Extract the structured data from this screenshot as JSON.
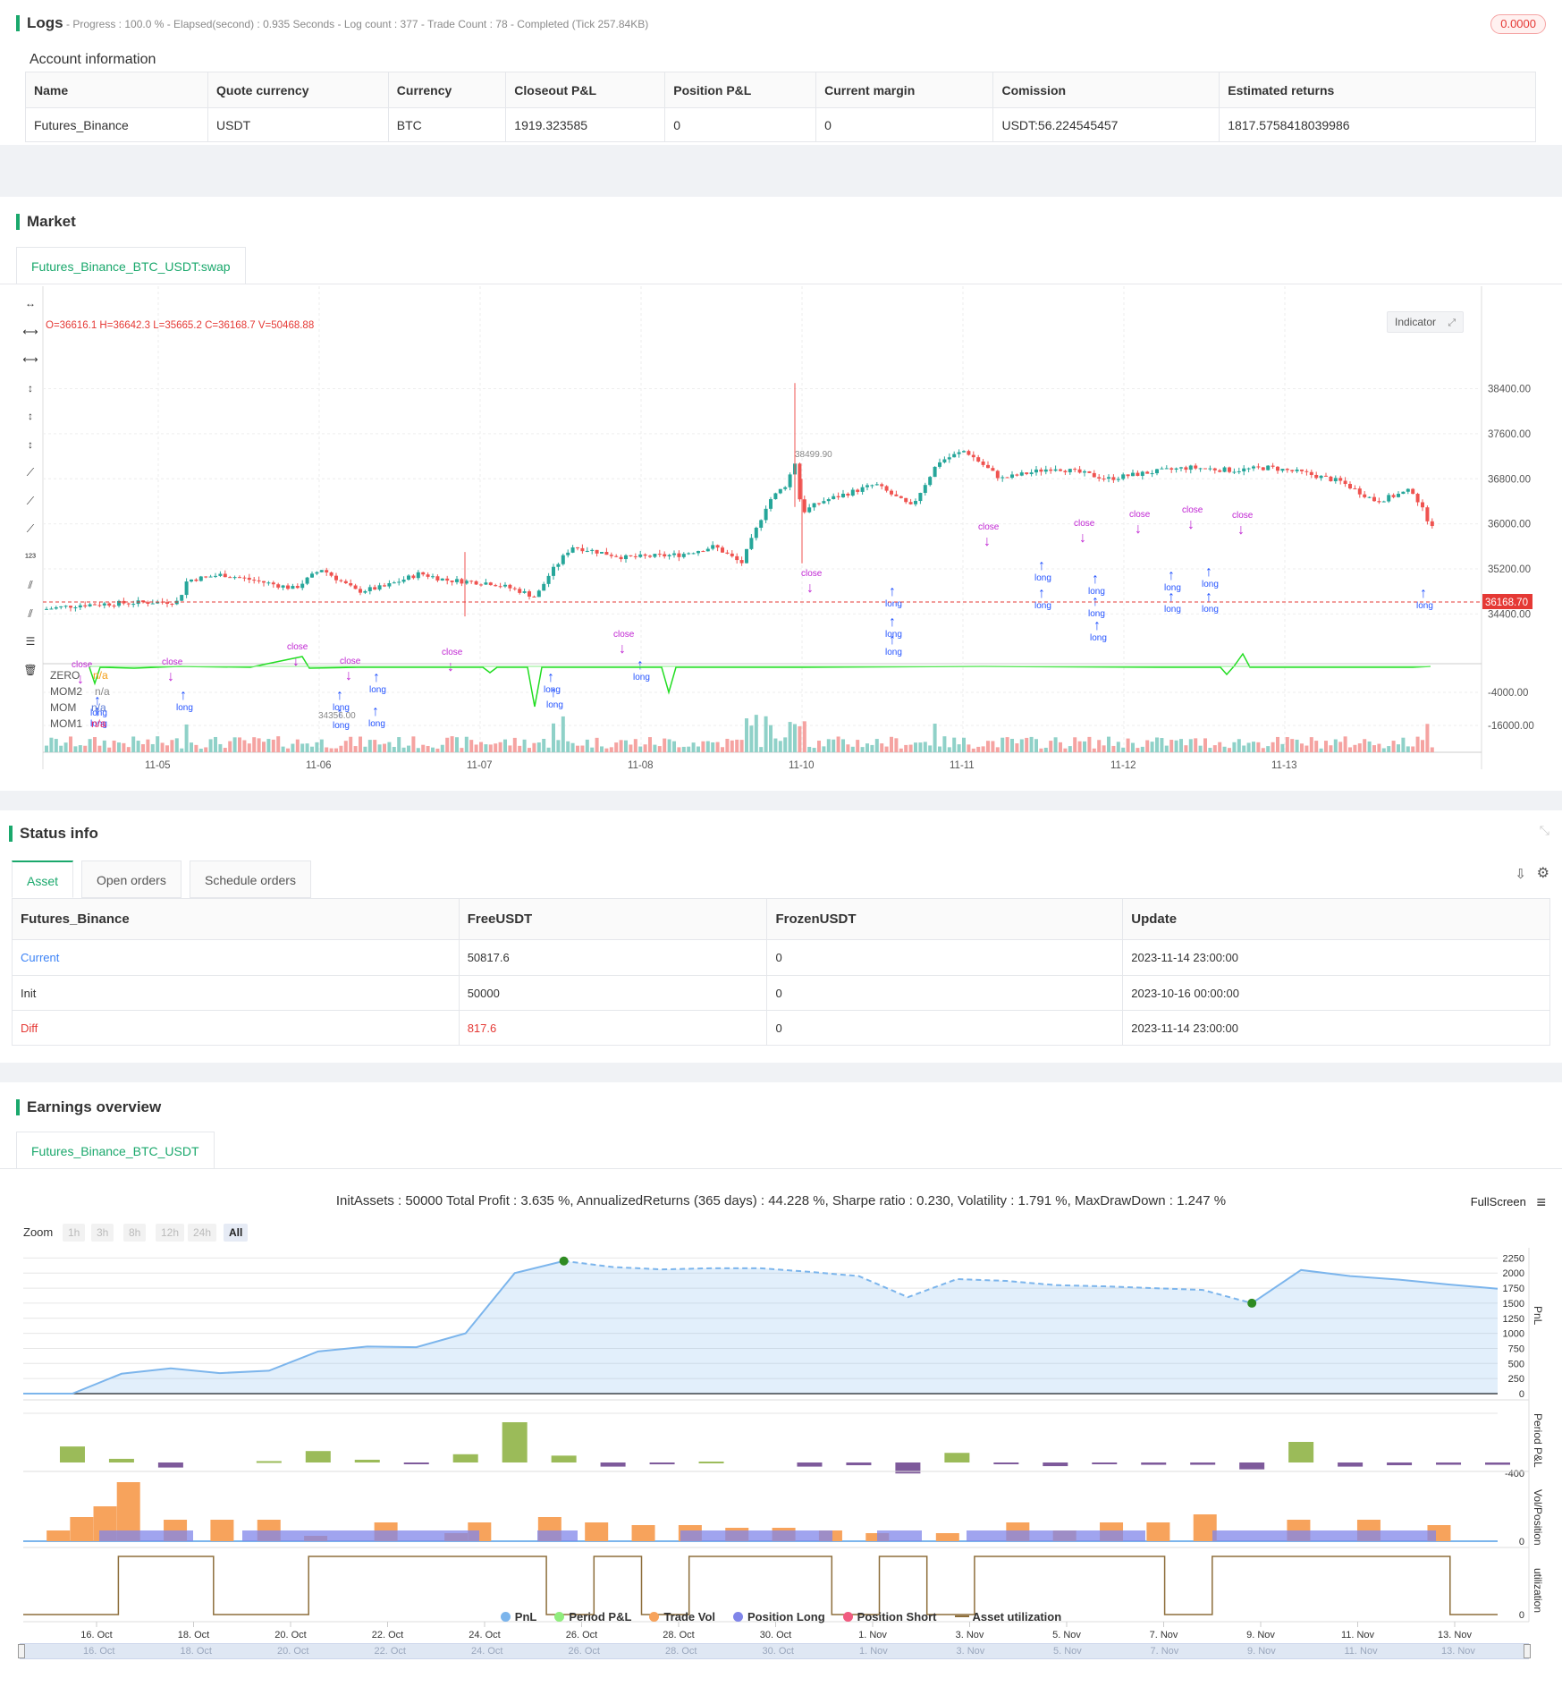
{
  "logs": {
    "title": "Logs",
    "progress_line": "- Progress : 100.0 % - Elapsed(second) : 0.935  Seconds - Log count : 377 - Trade Count : 78 - Completed (Tick 257.84KB)",
    "badge": "0.0000"
  },
  "account": {
    "heading": "Account information",
    "columns": [
      "Name",
      "Quote currency",
      "Currency",
      "Closeout P&L",
      "Position P&L",
      "Current margin",
      "Comission",
      "Estimated returns"
    ],
    "row": [
      "Futures_Binance",
      "USDT",
      "BTC",
      "1919.323585",
      "0",
      "0",
      "USDT:56.224545457",
      "1817.5758418039986"
    ]
  },
  "market": {
    "title": "Market",
    "tab": "Futures_Binance_BTC_USDT:swap",
    "ohlc": "O=36616.1 H=36642.3 L=35665.2 C=36168.7 V=50468.88",
    "indicator_btn": "Indicator",
    "price_axis": [
      "38400.00",
      "37600.00",
      "36800.00",
      "36000.00",
      "35200.00",
      "34400.00"
    ],
    "current_price": "36168.70",
    "high_label": "38499.90",
    "low_label": "34356.00",
    "mom_axis": [
      "-4000.00",
      "-16000.00"
    ],
    "date_axis": [
      "11-05",
      "11-06",
      "11-07",
      "11-08",
      "11-10",
      "11-11",
      "11-12",
      "11-13"
    ],
    "legend": [
      {
        "name": "ZERO",
        "value": "n/a",
        "color": "#f39c12"
      },
      {
        "name": "MOM2",
        "value": "n/a",
        "color": "#888888"
      },
      {
        "name": "MOM",
        "value": "n/a",
        "color": "#5b7bd5"
      },
      {
        "name": "MOM1",
        "value": "n/a",
        "color": "#e91e63"
      }
    ],
    "signal_close": "close",
    "signal_long": "long",
    "colors": {
      "up": "#26a69a",
      "down": "#ef5350",
      "close": "#c026d3",
      "long": "#2453ff",
      "mom": "#22dd22"
    }
  },
  "status": {
    "title": "Status info",
    "tabs": [
      "Asset",
      "Open orders",
      "Schedule orders"
    ],
    "columns": [
      "Futures_Binance",
      "FreeUSDT",
      "FrozenUSDT",
      "Update"
    ],
    "rows": [
      [
        "Current",
        "50817.6",
        "0",
        "2023-11-14 23:00:00"
      ],
      [
        "Init",
        "50000",
        "0",
        "2023-10-16 00:00:00"
      ],
      [
        "Diff",
        "817.6",
        "0",
        "2023-11-14 23:00:00"
      ]
    ]
  },
  "earnings": {
    "title": "Earnings overview",
    "tab": "Futures_Binance_BTC_USDT",
    "summary": "InitAssets : 50000 Total Profit : 3.635 %, AnnualizedReturns (365 days) : 44.228 %, Sharpe ratio : 0.230, Volatility : 1.791 %, MaxDrawDown : 1.247 %",
    "fullscreen": "FullScreen",
    "zoom_label": "Zoom",
    "zoom_options": [
      "1h",
      "3h",
      "8h",
      "12h",
      "24h",
      "All"
    ],
    "pnl_axis": [
      "2250",
      "2000",
      "1750",
      "1500",
      "1250",
      "1000",
      "750",
      "500",
      "250",
      "0"
    ],
    "period_axis": [
      "-400"
    ],
    "vol_axis": [
      "0"
    ],
    "util_axis": [
      "0"
    ],
    "panel_labels": [
      "PnL",
      "Period P&L",
      "Vol/Position",
      "utilization"
    ],
    "x_axis": [
      "16. Oct",
      "18. Oct",
      "20. Oct",
      "22. Oct",
      "24. Oct",
      "26. Oct",
      "28. Oct",
      "30. Oct",
      "1. Nov",
      "3. Nov",
      "5. Nov",
      "7. Nov",
      "9. Nov",
      "11. Nov",
      "13. Nov"
    ],
    "legend": [
      {
        "name": "PnL",
        "color": "#7cb5ec"
      },
      {
        "name": "Period P&L",
        "color": "#90ed7d"
      },
      {
        "name": "Trade Vol",
        "color": "#f7a35c"
      },
      {
        "name": "Position Long",
        "color": "#8085e9"
      },
      {
        "name": "Position Short",
        "color": "#f15c80"
      },
      {
        "name": "Asset utilization",
        "color": "#8d6e3b"
      }
    ],
    "pnl_series": [
      0,
      0,
      330,
      420,
      340,
      380,
      700,
      780,
      770,
      1000,
      2000,
      2200,
      2100,
      2060,
      2080,
      2080,
      2020,
      1950,
      1600,
      1900,
      1870,
      1800,
      1780,
      1750,
      1720,
      1500,
      2050,
      1950,
      1890,
      1810,
      1740
    ],
    "period_values": [
      0,
      350,
      80,
      -110,
      0,
      30,
      250,
      60,
      -30,
      180,
      880,
      150,
      -90,
      -40,
      20,
      0,
      -90,
      -60,
      -240,
      210,
      -20,
      -80,
      -20,
      -50,
      -50,
      -150,
      450,
      -90,
      -60,
      -50,
      -50
    ],
    "trade_vol": [
      0,
      20,
      45,
      65,
      110,
      0,
      40,
      0,
      40,
      0,
      40,
      0,
      10,
      0,
      0,
      35,
      0,
      0,
      15,
      35,
      0,
      0,
      45,
      0,
      35,
      0,
      30,
      0,
      30,
      0,
      25,
      0,
      25,
      0,
      20,
      0,
      15,
      0,
      0,
      15,
      0,
      0,
      35,
      0,
      20,
      0,
      35,
      0,
      35,
      0,
      50,
      0,
      0,
      0,
      40,
      0,
      0,
      40,
      0,
      0,
      30,
      0,
      0
    ],
    "util_pattern": [
      0,
      0,
      1,
      1,
      0,
      0,
      1,
      1,
      1,
      1,
      1,
      0,
      1,
      0,
      1,
      1,
      1,
      0,
      1,
      0,
      1,
      1,
      1,
      1,
      0,
      1,
      1,
      1,
      1,
      1,
      0
    ]
  }
}
